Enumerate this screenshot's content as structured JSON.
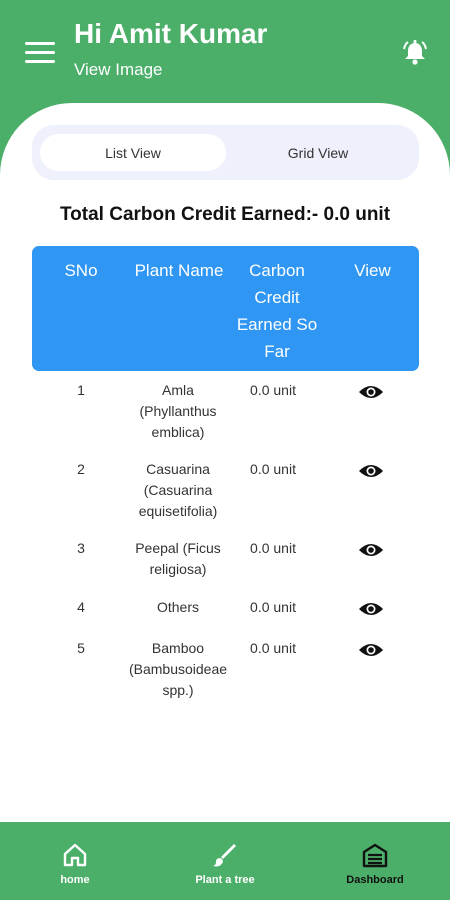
{
  "header": {
    "greeting": "Hi Amit Kumar",
    "subtitle": "View Image",
    "background_color": "#4caf69"
  },
  "view_toggle": {
    "options": [
      "List View",
      "Grid View"
    ],
    "selected": "List View"
  },
  "summary": {
    "total_label": "Total Carbon Credit Earned:- 0.0 unit"
  },
  "table": {
    "header_color": "#2f96f3",
    "columns": [
      "SNo",
      "Plant Name",
      "Carbon Credit Earned So Far",
      "View"
    ],
    "rows": [
      {
        "sno": "1",
        "plant": "Amla (Phyllanthus emblica)",
        "credit": "0.0 unit",
        "view_icon": "eye-icon"
      },
      {
        "sno": "2",
        "plant": "Casuarina (Casuarina equisetifolia)",
        "credit": "0.0 unit",
        "view_icon": "eye-icon"
      },
      {
        "sno": "3",
        "plant": "Peepal (Ficus religiosa)",
        "credit": "0.0 unit",
        "view_icon": "eye-icon"
      },
      {
        "sno": "4",
        "plant": "Others",
        "credit": "0.0 unit",
        "view_icon": "eye-icon"
      },
      {
        "sno": "5",
        "plant": "Bamboo (Bambusoideae spp.)",
        "credit": "0.0 unit",
        "view_icon": "eye-icon"
      }
    ]
  },
  "bottom_nav": {
    "items": [
      {
        "label": "home",
        "icon": "home-icon"
      },
      {
        "label": "Plant a tree",
        "icon": "brush-icon"
      },
      {
        "label": "Dashboard",
        "icon": "warehouse-icon"
      }
    ],
    "active": "Dashboard"
  }
}
